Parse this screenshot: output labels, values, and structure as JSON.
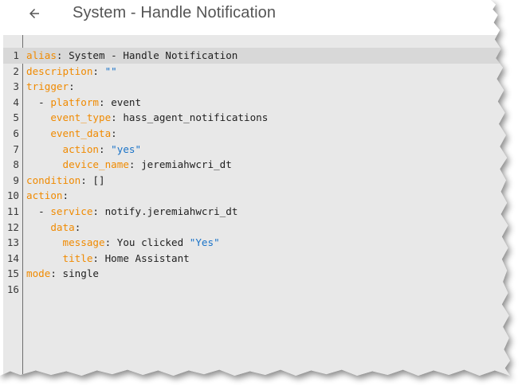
{
  "header": {
    "back_icon": "arrow-left-icon",
    "title": "System - Handle Notification"
  },
  "colors": {
    "key": "#f08a00",
    "string": "#1a73c8",
    "text": "#1f1f1f",
    "editor_bg": "#e8e8e8"
  },
  "editor": {
    "active_line": 1,
    "lines": [
      {
        "num": "1",
        "indent": "",
        "dash": "",
        "key": "alias",
        "sep": ": ",
        "value": "System - Handle Notification",
        "vtype": "v"
      },
      {
        "num": "2",
        "indent": "",
        "dash": "",
        "key": "description",
        "sep": ": ",
        "value": "\"\"",
        "vtype": "s"
      },
      {
        "num": "3",
        "indent": "",
        "dash": "",
        "key": "trigger",
        "sep": ":",
        "value": "",
        "vtype": "v"
      },
      {
        "num": "4",
        "indent": "  ",
        "dash": "- ",
        "key": "platform",
        "sep": ": ",
        "value": "event",
        "vtype": "v"
      },
      {
        "num": "5",
        "indent": "    ",
        "dash": "",
        "key": "event_type",
        "sep": ": ",
        "value": "hass_agent_notifications",
        "vtype": "v"
      },
      {
        "num": "6",
        "indent": "    ",
        "dash": "",
        "key": "event_data",
        "sep": ":",
        "value": "",
        "vtype": "v"
      },
      {
        "num": "7",
        "indent": "      ",
        "dash": "",
        "key": "action",
        "sep": ": ",
        "value": "\"yes\"",
        "vtype": "s"
      },
      {
        "num": "8",
        "indent": "      ",
        "dash": "",
        "key": "device_name",
        "sep": ": ",
        "value": "jeremiahwcri_dt",
        "vtype": "v"
      },
      {
        "num": "9",
        "indent": "",
        "dash": "",
        "key": "condition",
        "sep": ": ",
        "value": "[]",
        "vtype": "v"
      },
      {
        "num": "10",
        "indent": "",
        "dash": "",
        "key": "action",
        "sep": ":",
        "value": "",
        "vtype": "v"
      },
      {
        "num": "11",
        "indent": "  ",
        "dash": "- ",
        "key": "service",
        "sep": ": ",
        "value": "notify.jeremiahwcri_dt",
        "vtype": "v"
      },
      {
        "num": "12",
        "indent": "    ",
        "dash": "",
        "key": "data",
        "sep": ":",
        "value": "",
        "vtype": "v"
      },
      {
        "num": "13",
        "indent": "      ",
        "dash": "",
        "key": "message",
        "sep": ": ",
        "value": "You clicked ",
        "vtype": "v",
        "extra": "\"Yes\""
      },
      {
        "num": "14",
        "indent": "      ",
        "dash": "",
        "key": "title",
        "sep": ": ",
        "value": "Home Assistant",
        "vtype": "v"
      },
      {
        "num": "15",
        "indent": "",
        "dash": "",
        "key": "mode",
        "sep": ": ",
        "value": "single",
        "vtype": "v"
      },
      {
        "num": "16",
        "indent": "",
        "dash": "",
        "key": "",
        "sep": "",
        "value": "",
        "vtype": "v"
      }
    ]
  }
}
